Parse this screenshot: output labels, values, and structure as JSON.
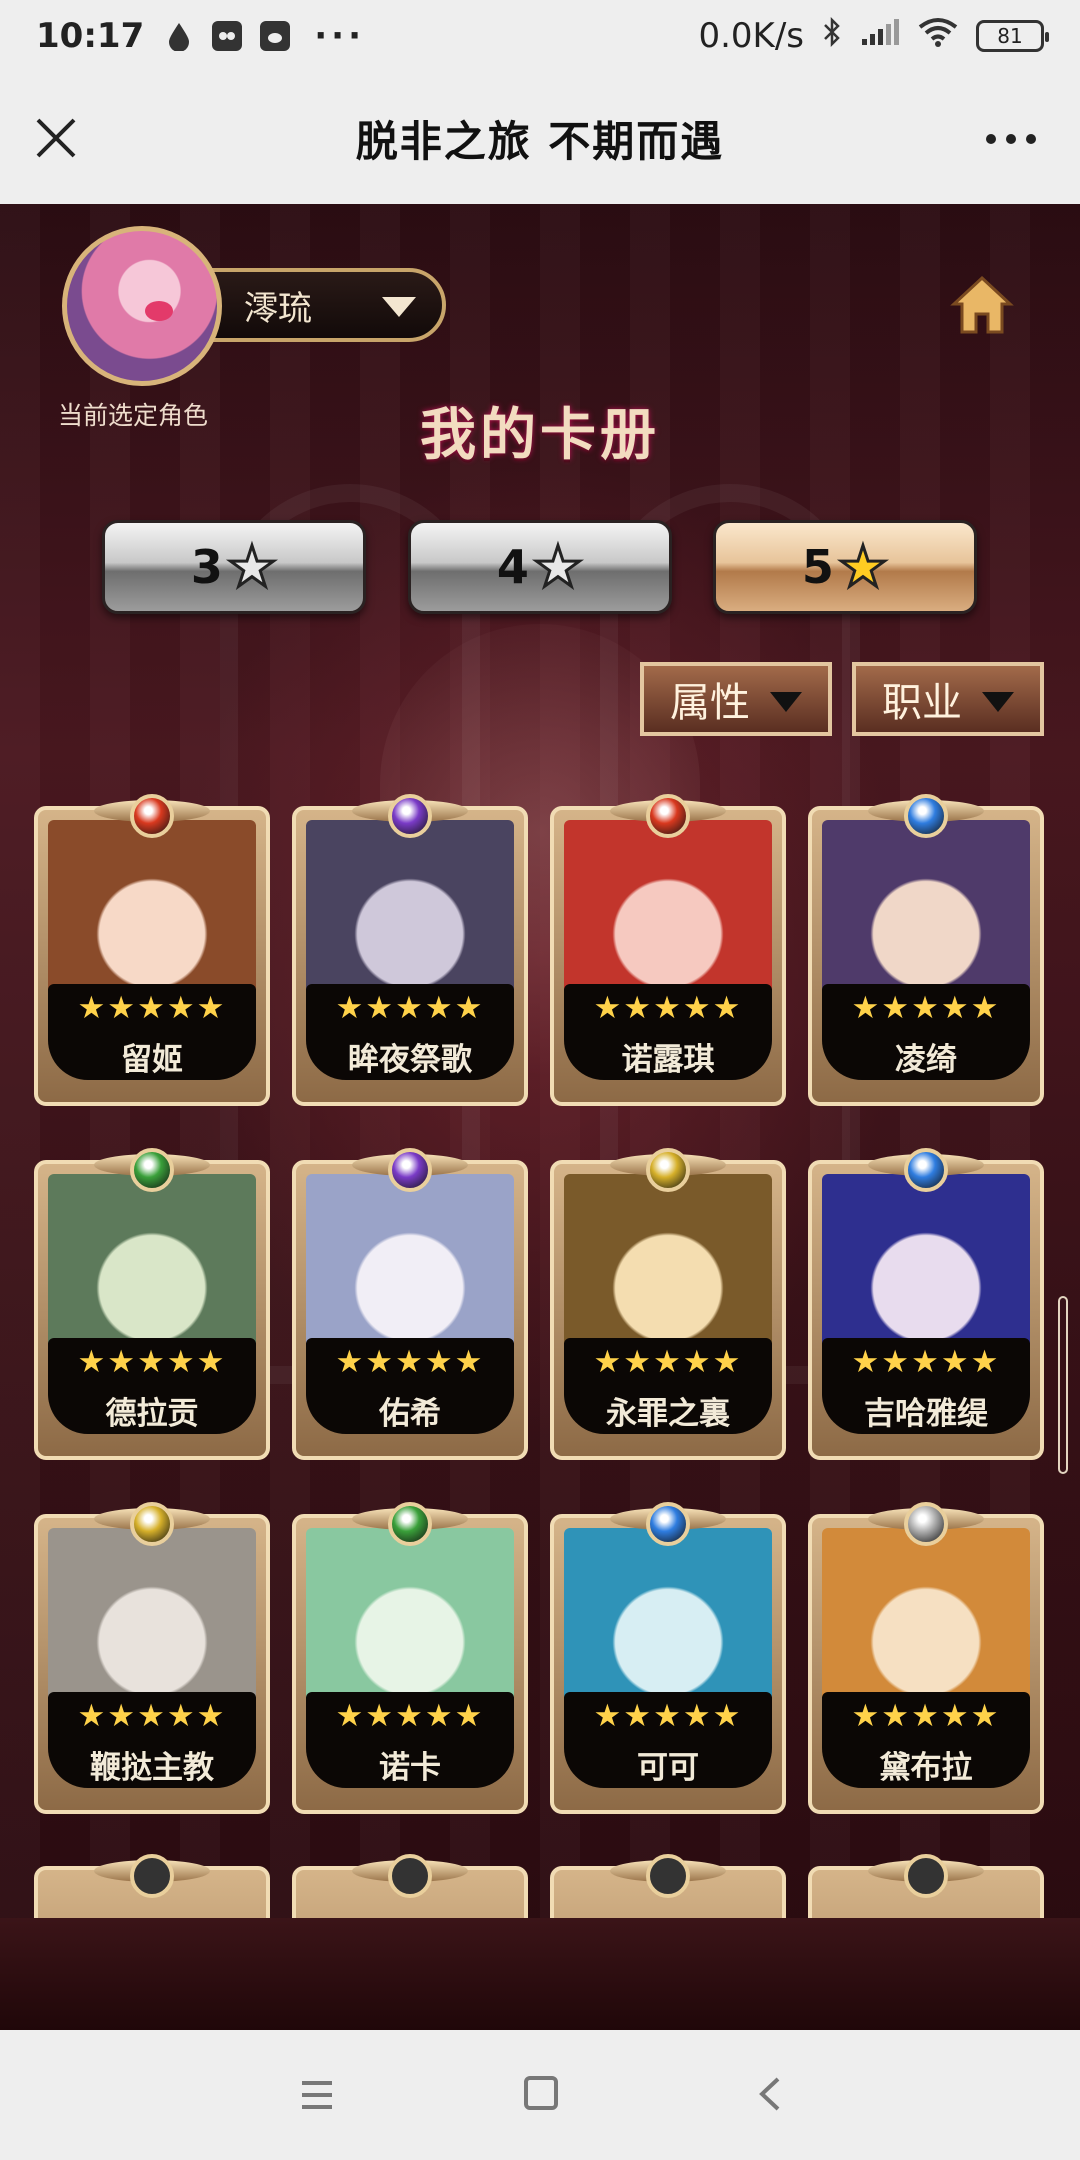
{
  "status_bar": {
    "time": "10:17",
    "dots": "···",
    "network_speed": "0.0K/s",
    "battery": "81",
    "icons": [
      "water-drop-icon",
      "app-icon",
      "weibo-icon",
      "bluetooth-icon",
      "signal-icon",
      "wifi-icon",
      "battery-icon"
    ]
  },
  "title_bar": {
    "title": "脱非之旅 不期而遇",
    "close_icon": "close-icon",
    "more_icon": "more-icon"
  },
  "profile": {
    "role_name": "澪琉",
    "caption": "当前选定角色"
  },
  "album_title": "我的卡册",
  "star_tabs": [
    {
      "label": "3",
      "symbol": "★",
      "selected": false
    },
    {
      "label": "4",
      "symbol": "★",
      "selected": false
    },
    {
      "label": "5",
      "symbol": "★",
      "selected": true
    }
  ],
  "filters": {
    "attribute_label": "属性",
    "class_label": "职业"
  },
  "cards": [
    {
      "name": "留姬",
      "stars": "★★★★★",
      "gem_color": "#d9391f"
    },
    {
      "name": "眸夜祭歌",
      "stars": "★★★★★",
      "gem_color": "#7a3bc7"
    },
    {
      "name": "诺露琪",
      "stars": "★★★★★",
      "gem_color": "#d9391f"
    },
    {
      "name": "凌绮",
      "stars": "★★★★★",
      "gem_color": "#2f7de0"
    },
    {
      "name": "德拉贡",
      "stars": "★★★★★",
      "gem_color": "#3aa03a"
    },
    {
      "name": "佑希",
      "stars": "★★★★★",
      "gem_color": "#7a3bc7"
    },
    {
      "name": "永罪之裏",
      "stars": "★★★★★",
      "gem_color": "#d6b02a"
    },
    {
      "name": "吉哈雅缇",
      "stars": "★★★★★",
      "gem_color": "#2f7de0"
    },
    {
      "name": "鞭挞主教",
      "stars": "★★★★★",
      "gem_color": "#d6b02a"
    },
    {
      "name": "诺卡",
      "stars": "★★★★★",
      "gem_color": "#3aa03a"
    },
    {
      "name": "可可",
      "stars": "★★★★★",
      "gem_color": "#2f7de0"
    },
    {
      "name": "黛布拉",
      "stars": "★★★★★",
      "gem_color": "#b0b0b0"
    }
  ],
  "nav_bar": {
    "menu_icon": "menu-icon",
    "home_icon": "square-home-icon",
    "back_icon": "back-icon"
  }
}
